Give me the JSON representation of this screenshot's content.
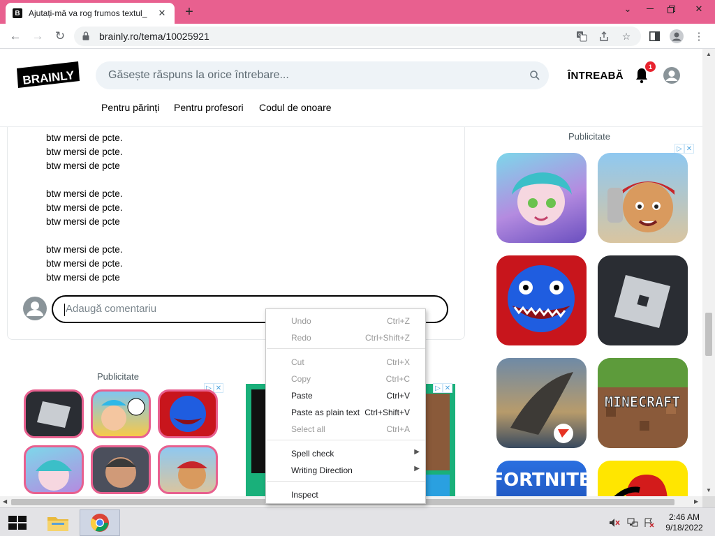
{
  "browser": {
    "tab_title": "Ajutați-mă va rog frumos textul_",
    "favicon": "B",
    "url": "brainly.ro/tema/10025921",
    "accent_color": "#e8608f"
  },
  "site": {
    "logo_text": "BRAINLY",
    "search_placeholder": "Găsește răspuns la orice întrebare...",
    "ask_label": "ÎNTREABĂ",
    "notification_count": "1",
    "subnav": [
      "Pentru părinți",
      "Pentru profesori",
      "Codul de onoare"
    ]
  },
  "answer": {
    "lines": [
      "btw mersi de pcte.",
      "btw mersi de pcte.",
      "btw mersi de pcte",
      "btw mersi de pcte.",
      "btw mersi de pcte.",
      "btw mersi de pcte",
      "btw mersi de pcte.",
      "btw mersi de pcte.",
      "btw mersi de pcte"
    ],
    "comment_placeholder": "Adaugă comentariu"
  },
  "ads": {
    "label_right": "Publicitate",
    "label_left": "Publicitate",
    "right_apps": [
      "anime-girl-game",
      "subway-surfers",
      "huggy-wuggy",
      "roblox",
      "freefire",
      "minecraft",
      "fortnite",
      "among-us"
    ],
    "minecraft_text": "MINECRAFT",
    "fortnite_text": "FORTNITE"
  },
  "context_menu": {
    "items": [
      {
        "label": "Undo",
        "shortcut": "Ctrl+Z",
        "disabled": true
      },
      {
        "label": "Redo",
        "shortcut": "Ctrl+Shift+Z",
        "disabled": true
      },
      {
        "label": "Cut",
        "shortcut": "Ctrl+X",
        "disabled": true
      },
      {
        "label": "Copy",
        "shortcut": "Ctrl+C",
        "disabled": true
      },
      {
        "label": "Paste",
        "shortcut": "Ctrl+V",
        "disabled": false
      },
      {
        "label": "Paste as plain text",
        "shortcut": "Ctrl+Shift+V",
        "disabled": false
      },
      {
        "label": "Select all",
        "shortcut": "Ctrl+A",
        "disabled": true
      },
      {
        "label": "Spell check",
        "shortcut": "",
        "disabled": false
      },
      {
        "label": "Writing Direction",
        "shortcut": "",
        "disabled": false
      },
      {
        "label": "Inspect",
        "shortcut": "",
        "disabled": false
      }
    ]
  },
  "taskbar": {
    "time": "2:46 AM",
    "date": "9/18/2022"
  }
}
